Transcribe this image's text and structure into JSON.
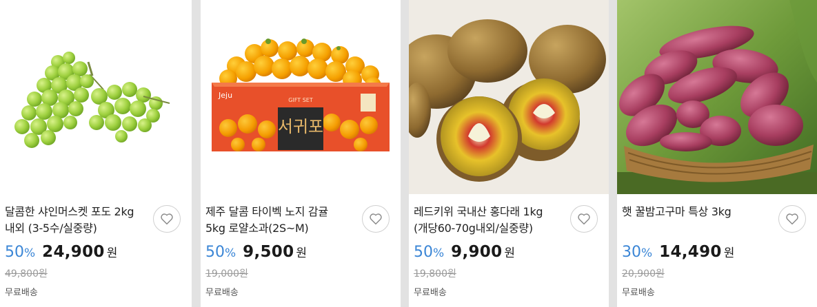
{
  "products": [
    {
      "title": "달콤한 샤인머스켓 포도 2kg 내외 (3-5수/실중량)",
      "rate": "50",
      "pct": "%",
      "price": "24,900",
      "currency": "원",
      "original_price": "49,800원",
      "shipping": "무료배송"
    },
    {
      "title": "제주 달콤 타이벡 노지 감귤 5kg 로얄소과(2S~M)",
      "rate": "50",
      "pct": "%",
      "price": "9,500",
      "currency": "원",
      "original_price": "19,000원",
      "shipping": "무료배송",
      "box_label_top": "GIFT SET",
      "box_brand": "Jeju",
      "box_title": "서귀포"
    },
    {
      "title": "레드키위 국내산 홍다래 1kg (개당60-70g내외/실중량)",
      "rate": "50",
      "pct": "%",
      "price": "9,900",
      "currency": "원",
      "original_price": "19,800원",
      "shipping": "무료배송"
    },
    {
      "title": "햇 꿀밤고구마 특상 3kg",
      "rate": "30",
      "pct": "%",
      "price": "14,490",
      "currency": "원",
      "original_price": "20,900원",
      "shipping": "무료배송"
    }
  ],
  "colors": {
    "accent": "#3b86d6",
    "price": "#1a1a1a",
    "strike": "#9a9a9a"
  },
  "icons": {
    "wishlist": "heart-outline-icon"
  }
}
